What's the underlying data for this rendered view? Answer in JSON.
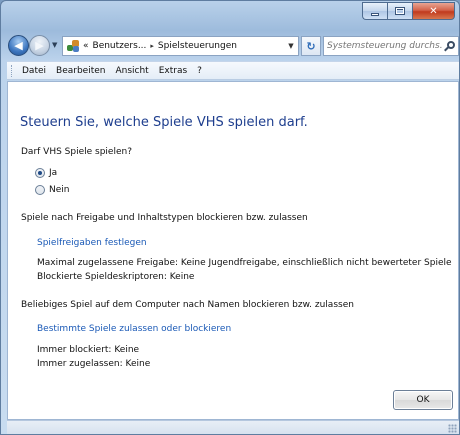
{
  "window": {
    "caption_buttons": {
      "minimize": "minimize",
      "maximize": "maximize",
      "close": "✕"
    }
  },
  "navigation": {
    "back_glyph": "◀",
    "forward_glyph": "▶",
    "address": {
      "breadcrumbs": [
        "Benutzers...",
        "Spielsteuerungen"
      ],
      "prefix": "«",
      "separator": "▸"
    },
    "refresh_glyph": "↻",
    "search": {
      "placeholder": "Systemsteuerung durchs..."
    }
  },
  "menu": {
    "items": [
      "Datei",
      "Bearbeiten",
      "Ansicht",
      "Extras",
      "?"
    ]
  },
  "page": {
    "heading": "Steuern Sie, welche Spiele VHS spielen darf.",
    "question": "Darf VHS Spiele spielen?",
    "options": [
      {
        "label": "Ja",
        "selected": true
      },
      {
        "label": "Nein",
        "selected": false
      }
    ],
    "section1": {
      "title": "Spiele nach Freigabe und Inhaltstypen blockieren bzw. zulassen",
      "link": "Spielfreigaben festlegen",
      "line1": "Maximal zugelassene Freigabe:  Keine Jugendfreigabe, einschließlich nicht bewerteter Spiele",
      "line2": "Blockierte Spieldeskriptoren:  Keine"
    },
    "section2": {
      "title": "Beliebiges Spiel auf dem Computer nach Namen blockieren bzw. zulassen",
      "link": "Bestimmte Spiele zulassen oder blockieren",
      "line1": "Immer blockiert:  Keine",
      "line2": "Immer zugelassen:  Keine"
    },
    "ok_label": "OK"
  }
}
